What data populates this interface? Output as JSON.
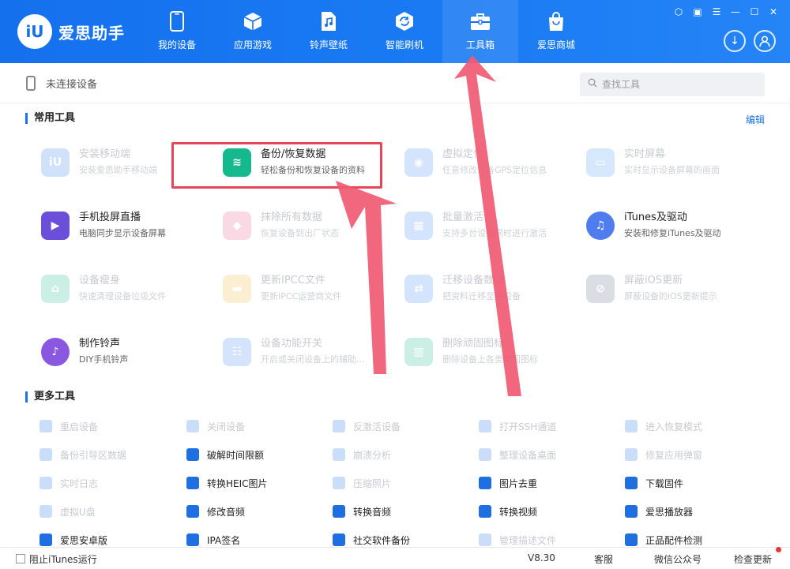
{
  "app": {
    "name": "爱思助手",
    "logo_text": "iU"
  },
  "nav": [
    {
      "label": "我的设备",
      "icon": "phone-icon"
    },
    {
      "label": "应用游戏",
      "icon": "cube-icon"
    },
    {
      "label": "铃声壁纸",
      "icon": "music-file-icon"
    },
    {
      "label": "智能刷机",
      "icon": "refresh-box-icon"
    },
    {
      "label": "工具箱",
      "icon": "toolbox-icon",
      "active": true
    },
    {
      "label": "爱思商城",
      "icon": "shopping-bag-icon"
    }
  ],
  "window_controls": [
    "skin-icon",
    "feedback-icon",
    "menu-icon",
    "minimize-icon",
    "maximize-icon",
    "close-icon"
  ],
  "device": {
    "status": "未连接设备"
  },
  "search": {
    "placeholder": "查找工具"
  },
  "common": {
    "title": "常用工具",
    "edit": "编辑",
    "tools": [
      {
        "name": "安装移动端",
        "desc": "安装爱思助手移动端",
        "icon": "iu-icon",
        "color": "#2b7de9",
        "enabled": false
      },
      {
        "name": "备份/恢复数据",
        "desc": "轻松备份和恢复设备的资料",
        "icon": "layers-icon",
        "color": "#16b88d",
        "enabled": true
      },
      {
        "name": "虚拟定位",
        "desc": "任意修改设备GPS定位信息",
        "icon": "location-pin-icon",
        "color": "#3d86f5",
        "enabled": false
      },
      {
        "name": "实时屏幕",
        "desc": "实时显示设备屏幕的画面",
        "icon": "screen-icon",
        "color": "#4a9bf2",
        "enabled": false
      },
      {
        "name": "手机投屏直播",
        "desc": "电脑同步显示设备屏幕",
        "icon": "cast-play-icon",
        "color": "#6b4fd8",
        "enabled": true
      },
      {
        "name": "抹除所有数据",
        "desc": "恢复设备到出厂状态",
        "icon": "eraser-icon",
        "color": "#e85a8a",
        "enabled": false
      },
      {
        "name": "批量激活",
        "desc": "支持多台设备同时进行激活",
        "icon": "batch-activate-icon",
        "color": "#3d86f5",
        "enabled": false
      },
      {
        "name": "iTunes及驱动",
        "desc": "安装和修复iTunes及驱动",
        "icon": "itunes-music-icon",
        "color": "#4f7df0",
        "enabled": true
      },
      {
        "name": "设备瘦身",
        "desc": "快速清理设备垃圾文件",
        "icon": "broom-icon",
        "color": "#16b88d",
        "enabled": false
      },
      {
        "name": "更新IPCC文件",
        "desc": "更新IPCC运营商文件",
        "icon": "folder-icon",
        "color": "#f2b632",
        "enabled": false
      },
      {
        "name": "迁移设备数据",
        "desc": "把资料迁移至新设备",
        "icon": "transfer-icon",
        "color": "#3d86f5",
        "enabled": false
      },
      {
        "name": "屏蔽iOS更新",
        "desc": "屏蔽设备的iOS更新提示",
        "icon": "block-update-icon",
        "color": "#5a6b8a",
        "enabled": false
      },
      {
        "name": "制作铃声",
        "desc": "DIY手机铃声",
        "icon": "ringtone-icon",
        "color": "#8a57e0",
        "enabled": true
      },
      {
        "name": "设备功能开关",
        "desc": "开启或关闭设备上的辅助...",
        "icon": "sliders-icon",
        "color": "#3d86f5",
        "enabled": false
      },
      {
        "name": "删除顽固图标",
        "desc": "删除设备上各类顽固图标",
        "icon": "trash-icon",
        "color": "#16b88d",
        "enabled": false
      }
    ]
  },
  "more": {
    "title": "更多工具",
    "tools": [
      {
        "name": "重启设备",
        "icon": "restart-icon",
        "color": "#2b7de9",
        "enabled": false
      },
      {
        "name": "关闭设备",
        "icon": "power-icon",
        "color": "#2b7de9",
        "enabled": false
      },
      {
        "name": "反激活设备",
        "icon": "deactivate-icon",
        "color": "#2b7de9",
        "enabled": false
      },
      {
        "name": "打开SSH通道",
        "icon": "ssh-icon",
        "color": "#2b7de9",
        "enabled": false
      },
      {
        "name": "进入恢复模式",
        "icon": "recovery-icon",
        "color": "#2b7de9",
        "enabled": false
      },
      {
        "name": "备份引导区数据",
        "icon": "boot-backup-icon",
        "color": "#2b7de9",
        "enabled": false
      },
      {
        "name": "破解时间限额",
        "icon": "clock-icon",
        "color": "#1f6fe0",
        "enabled": true
      },
      {
        "name": "崩溃分析",
        "icon": "crash-icon",
        "color": "#2b7de9",
        "enabled": false
      },
      {
        "name": "整理设备桌面",
        "icon": "grid-icon",
        "color": "#2b7de9",
        "enabled": false
      },
      {
        "name": "修复应用弹窗",
        "icon": "fix-popup-icon",
        "color": "#2b7de9",
        "enabled": false
      },
      {
        "name": "实时日志",
        "icon": "log-icon",
        "color": "#2b7de9",
        "enabled": false
      },
      {
        "name": "转换HEIC图片",
        "icon": "heic-icon",
        "color": "#1f6fe0",
        "enabled": true
      },
      {
        "name": "压缩照片",
        "icon": "compress-icon",
        "color": "#2b7de9",
        "enabled": false
      },
      {
        "name": "图片去重",
        "icon": "chart-icon",
        "color": "#1f6fe0",
        "enabled": true
      },
      {
        "name": "下载固件",
        "icon": "firmware-icon",
        "color": "#1f6fe0",
        "enabled": true
      },
      {
        "name": "虚拟U盘",
        "icon": "usb-icon",
        "color": "#2b7de9",
        "enabled": false
      },
      {
        "name": "修改音频",
        "icon": "audio-edit-icon",
        "color": "#1f6fe0",
        "enabled": true
      },
      {
        "name": "转换音频",
        "icon": "audio-convert-icon",
        "color": "#1f6fe0",
        "enabled": true
      },
      {
        "name": "转换视频",
        "icon": "video-convert-icon",
        "color": "#1f6fe0",
        "enabled": true
      },
      {
        "name": "爱思播放器",
        "icon": "player-icon",
        "color": "#1f6fe0",
        "enabled": true
      },
      {
        "name": "爱思安卓版",
        "icon": "android-iu-icon",
        "color": "#1f6fe0",
        "enabled": true
      },
      {
        "name": "IPA签名",
        "icon": "ipa-icon",
        "color": "#1f6fe0",
        "enabled": true
      },
      {
        "name": "社交软件备份",
        "icon": "social-backup-icon",
        "color": "#1f6fe0",
        "enabled": true
      },
      {
        "name": "管理描述文件",
        "icon": "profile-icon",
        "color": "#2b7de9",
        "enabled": false
      },
      {
        "name": "正品配件检测",
        "icon": "accessory-icon",
        "color": "#1f6fe0",
        "enabled": true
      }
    ]
  },
  "footer": {
    "block_itunes": "阻止iTunes运行",
    "version": "V8.30",
    "service": "客服",
    "wechat": "微信公众号",
    "update": "检查更新"
  },
  "colors": {
    "header": "#1570ee",
    "accent": "#1a73e8",
    "highlight": "#e8445a",
    "arrow": "#f0506a"
  }
}
